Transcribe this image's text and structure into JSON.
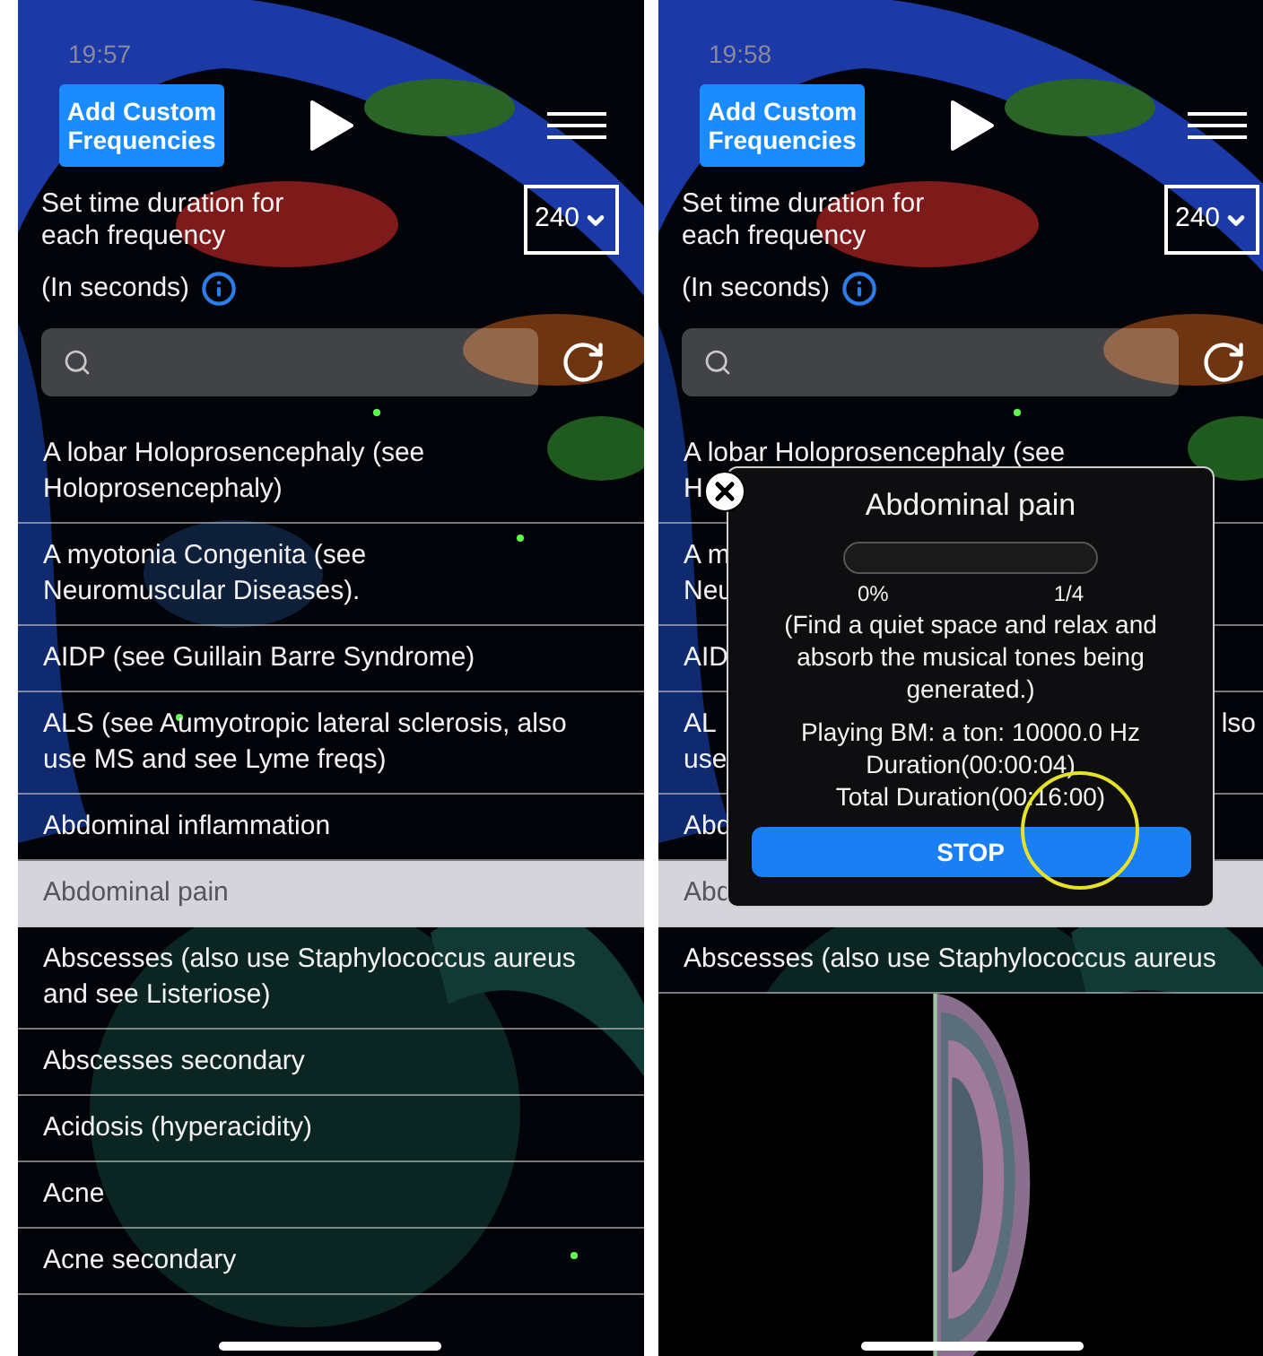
{
  "screens": [
    {
      "time": "19:57",
      "add_button": "Add Custom Frequencies",
      "duration_label": "Set time duration for each frequency",
      "seconds_label": "(In seconds)",
      "duration_select": "240",
      "list": [
        {
          "lines": [
            "A lobar Holoprosencephaly (see",
            "Holoprosencephaly)"
          ],
          "selected": false
        },
        {
          "lines": [
            "A myotonia Congenita (see",
            "Neuromuscular Diseases)."
          ],
          "selected": false
        },
        {
          "lines": [
            "AIDP (see Guillain Barre Syndrome)"
          ],
          "selected": false
        },
        {
          "lines": [
            "ALS (see Aumyotropic lateral sclerosis, also",
            "use MS and see Lyme freqs)"
          ],
          "selected": false
        },
        {
          "lines": [
            "Abdominal inflammation"
          ],
          "selected": false
        },
        {
          "lines": [
            "Abdominal pain"
          ],
          "selected": true
        },
        {
          "lines": [
            "Abscesses (also use Staphylococcus aureus",
            "and see Listeriose)"
          ],
          "selected": false
        },
        {
          "lines": [
            "Abscesses secondary"
          ],
          "selected": false
        },
        {
          "lines": [
            "Acidosis (hyperacidity)"
          ],
          "selected": false
        },
        {
          "lines": [
            "Acne"
          ],
          "selected": false
        },
        {
          "lines": [
            "Acne secondary"
          ],
          "selected": false
        }
      ]
    },
    {
      "time": "19:58",
      "add_button": "Add Custom Frequencies",
      "duration_label": "Set time duration for each frequency",
      "seconds_label": "(In seconds)",
      "duration_select": "240",
      "list": [
        {
          "lines": [
            "A lobar Holoprosencephaly (see",
            "H"
          ],
          "selected": false
        },
        {
          "lines": [
            "A m",
            "Neu"
          ],
          "selected": false
        },
        {
          "lines": [
            "AID"
          ],
          "selected": false
        },
        {
          "lines": [
            "AL",
            "use"
          ],
          "tail": "lso",
          "selected": false
        },
        {
          "lines": [
            "Abd"
          ],
          "selected": false
        },
        {
          "lines": [
            "Abd"
          ],
          "selected": true
        },
        {
          "lines": [
            "Abscesses (also use Staphylococcus aureus"
          ],
          "selected": false
        }
      ],
      "modal": {
        "title": "Abdominal pain",
        "progress": {
          "level": 0
        },
        "percent": "0%",
        "step": "1/4",
        "message": "(Find a quiet space and relax and absorb the musical tones being generated.)",
        "playing": "Playing BM: a ton: 10000.0 Hz",
        "duration": "Duration(00:00:04)",
        "total": "Total Duration(00:16:00)",
        "stop_button": "STOP"
      }
    }
  ]
}
